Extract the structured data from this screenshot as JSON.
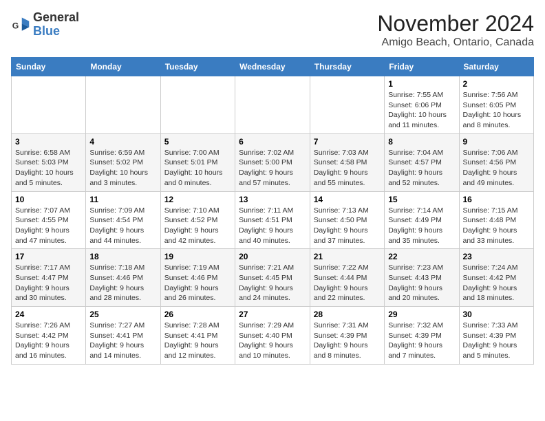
{
  "header": {
    "logo_general": "General",
    "logo_blue": "Blue",
    "title": "November 2024",
    "subtitle": "Amigo Beach, Ontario, Canada"
  },
  "days_of_week": [
    "Sunday",
    "Monday",
    "Tuesday",
    "Wednesday",
    "Thursday",
    "Friday",
    "Saturday"
  ],
  "weeks": [
    [
      {
        "day": "",
        "info": ""
      },
      {
        "day": "",
        "info": ""
      },
      {
        "day": "",
        "info": ""
      },
      {
        "day": "",
        "info": ""
      },
      {
        "day": "",
        "info": ""
      },
      {
        "day": "1",
        "info": "Sunrise: 7:55 AM\nSunset: 6:06 PM\nDaylight: 10 hours and 11 minutes."
      },
      {
        "day": "2",
        "info": "Sunrise: 7:56 AM\nSunset: 6:05 PM\nDaylight: 10 hours and 8 minutes."
      }
    ],
    [
      {
        "day": "3",
        "info": "Sunrise: 6:58 AM\nSunset: 5:03 PM\nDaylight: 10 hours and 5 minutes."
      },
      {
        "day": "4",
        "info": "Sunrise: 6:59 AM\nSunset: 5:02 PM\nDaylight: 10 hours and 3 minutes."
      },
      {
        "day": "5",
        "info": "Sunrise: 7:00 AM\nSunset: 5:01 PM\nDaylight: 10 hours and 0 minutes."
      },
      {
        "day": "6",
        "info": "Sunrise: 7:02 AM\nSunset: 5:00 PM\nDaylight: 9 hours and 57 minutes."
      },
      {
        "day": "7",
        "info": "Sunrise: 7:03 AM\nSunset: 4:58 PM\nDaylight: 9 hours and 55 minutes."
      },
      {
        "day": "8",
        "info": "Sunrise: 7:04 AM\nSunset: 4:57 PM\nDaylight: 9 hours and 52 minutes."
      },
      {
        "day": "9",
        "info": "Sunrise: 7:06 AM\nSunset: 4:56 PM\nDaylight: 9 hours and 49 minutes."
      }
    ],
    [
      {
        "day": "10",
        "info": "Sunrise: 7:07 AM\nSunset: 4:55 PM\nDaylight: 9 hours and 47 minutes."
      },
      {
        "day": "11",
        "info": "Sunrise: 7:09 AM\nSunset: 4:54 PM\nDaylight: 9 hours and 44 minutes."
      },
      {
        "day": "12",
        "info": "Sunrise: 7:10 AM\nSunset: 4:52 PM\nDaylight: 9 hours and 42 minutes."
      },
      {
        "day": "13",
        "info": "Sunrise: 7:11 AM\nSunset: 4:51 PM\nDaylight: 9 hours and 40 minutes."
      },
      {
        "day": "14",
        "info": "Sunrise: 7:13 AM\nSunset: 4:50 PM\nDaylight: 9 hours and 37 minutes."
      },
      {
        "day": "15",
        "info": "Sunrise: 7:14 AM\nSunset: 4:49 PM\nDaylight: 9 hours and 35 minutes."
      },
      {
        "day": "16",
        "info": "Sunrise: 7:15 AM\nSunset: 4:48 PM\nDaylight: 9 hours and 33 minutes."
      }
    ],
    [
      {
        "day": "17",
        "info": "Sunrise: 7:17 AM\nSunset: 4:47 PM\nDaylight: 9 hours and 30 minutes."
      },
      {
        "day": "18",
        "info": "Sunrise: 7:18 AM\nSunset: 4:46 PM\nDaylight: 9 hours and 28 minutes."
      },
      {
        "day": "19",
        "info": "Sunrise: 7:19 AM\nSunset: 4:46 PM\nDaylight: 9 hours and 26 minutes."
      },
      {
        "day": "20",
        "info": "Sunrise: 7:21 AM\nSunset: 4:45 PM\nDaylight: 9 hours and 24 minutes."
      },
      {
        "day": "21",
        "info": "Sunrise: 7:22 AM\nSunset: 4:44 PM\nDaylight: 9 hours and 22 minutes."
      },
      {
        "day": "22",
        "info": "Sunrise: 7:23 AM\nSunset: 4:43 PM\nDaylight: 9 hours and 20 minutes."
      },
      {
        "day": "23",
        "info": "Sunrise: 7:24 AM\nSunset: 4:42 PM\nDaylight: 9 hours and 18 minutes."
      }
    ],
    [
      {
        "day": "24",
        "info": "Sunrise: 7:26 AM\nSunset: 4:42 PM\nDaylight: 9 hours and 16 minutes."
      },
      {
        "day": "25",
        "info": "Sunrise: 7:27 AM\nSunset: 4:41 PM\nDaylight: 9 hours and 14 minutes."
      },
      {
        "day": "26",
        "info": "Sunrise: 7:28 AM\nSunset: 4:41 PM\nDaylight: 9 hours and 12 minutes."
      },
      {
        "day": "27",
        "info": "Sunrise: 7:29 AM\nSunset: 4:40 PM\nDaylight: 9 hours and 10 minutes."
      },
      {
        "day": "28",
        "info": "Sunrise: 7:31 AM\nSunset: 4:39 PM\nDaylight: 9 hours and 8 minutes."
      },
      {
        "day": "29",
        "info": "Sunrise: 7:32 AM\nSunset: 4:39 PM\nDaylight: 9 hours and 7 minutes."
      },
      {
        "day": "30",
        "info": "Sunrise: 7:33 AM\nSunset: 4:39 PM\nDaylight: 9 hours and 5 minutes."
      }
    ]
  ]
}
